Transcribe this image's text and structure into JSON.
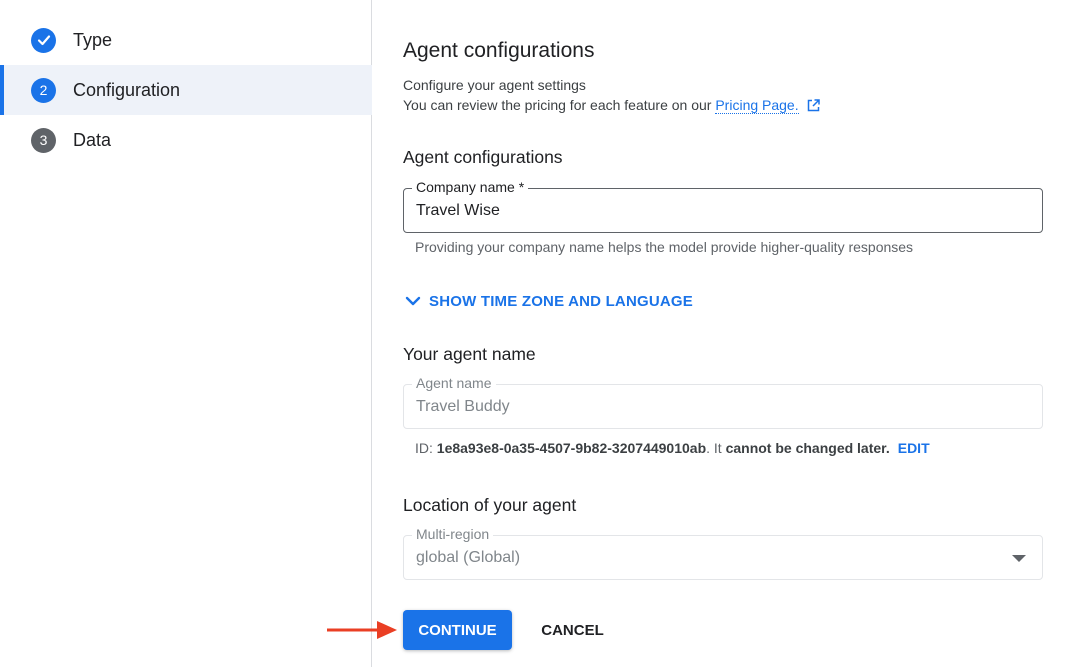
{
  "stepper": {
    "steps": [
      {
        "number": "",
        "label": "Type",
        "state": "done"
      },
      {
        "number": "2",
        "label": "Configuration",
        "state": "current"
      },
      {
        "number": "3",
        "label": "Data",
        "state": "pending"
      }
    ]
  },
  "header": {
    "title": "Agent configurations",
    "desc_line1": "Configure your agent settings",
    "desc_line2": "You can review the pricing for each feature on our",
    "pricing_link": "Pricing Page."
  },
  "company_section": {
    "heading": "Agent configurations",
    "field_label": "Company name *",
    "field_value": "Travel Wise",
    "hint": "Providing your company name helps the model provide higher-quality responses"
  },
  "timezone_toggle": {
    "label": "SHOW TIME ZONE AND LANGUAGE"
  },
  "agent_name_section": {
    "heading": "Your agent name",
    "field_label": "Agent name",
    "field_value": "Travel Buddy",
    "id_prefix": "ID: ",
    "id_value": "1e8a93e8-0a35-4507-9b82-3207449010ab",
    "id_middle": ". It ",
    "id_warning": "cannot be changed later.",
    "edit_label": "EDIT"
  },
  "location_section": {
    "heading": "Location of your agent",
    "field_label": "Multi-region",
    "field_value": "global (Global)"
  },
  "actions": {
    "continue_label": "CONTINUE",
    "cancel_label": "CANCEL"
  },
  "colors": {
    "accent": "#1a73e8",
    "annotation_arrow": "#ea3f24"
  }
}
